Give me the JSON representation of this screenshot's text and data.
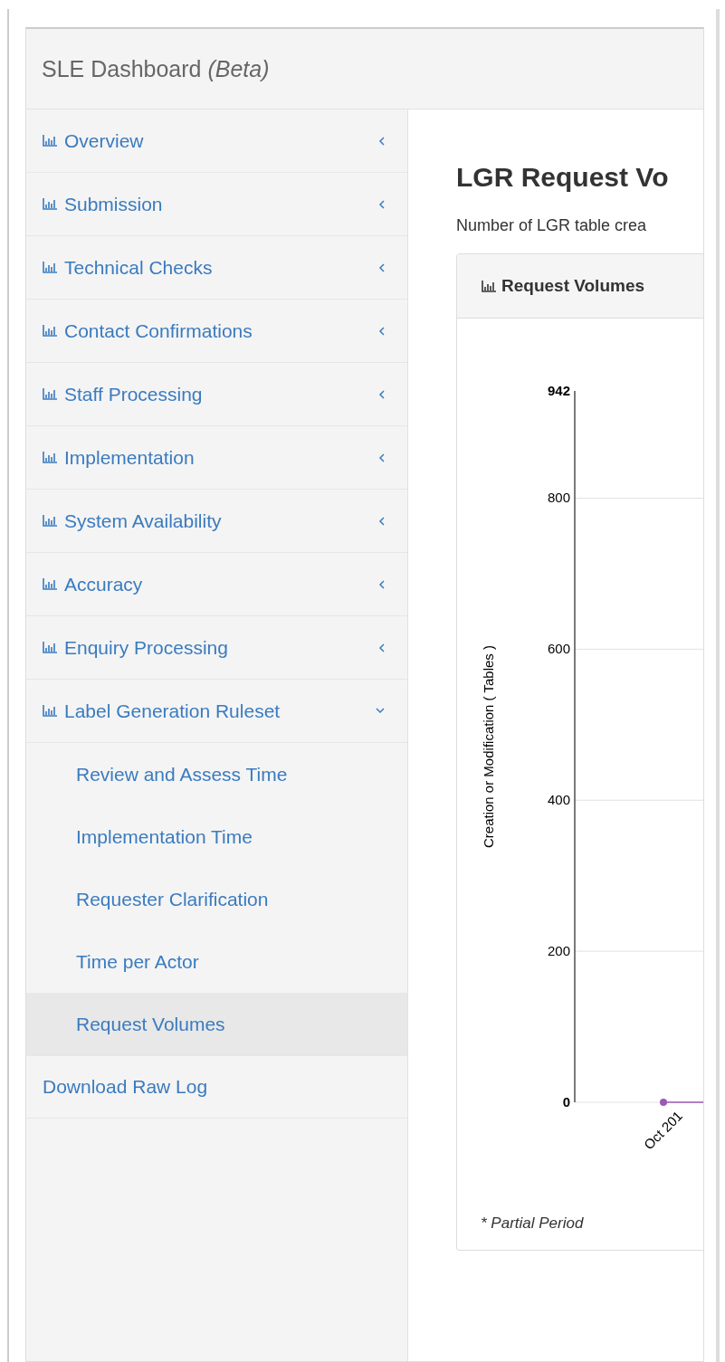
{
  "header": {
    "title": "SLE Dashboard",
    "badge": "(Beta)"
  },
  "sidebar": {
    "items": [
      {
        "kind": "group",
        "label": "Overview",
        "expanded": false
      },
      {
        "kind": "group",
        "label": "Submission",
        "expanded": false
      },
      {
        "kind": "group",
        "label": "Technical Checks",
        "expanded": false
      },
      {
        "kind": "group",
        "label": "Contact Confirmations",
        "expanded": false
      },
      {
        "kind": "group",
        "label": "Staff Processing",
        "expanded": false
      },
      {
        "kind": "group",
        "label": "Implementation",
        "expanded": false
      },
      {
        "kind": "group",
        "label": "System Availability",
        "expanded": false
      },
      {
        "kind": "group",
        "label": "Accuracy",
        "expanded": false
      },
      {
        "kind": "group",
        "label": "Enquiry Processing",
        "expanded": false
      },
      {
        "kind": "group",
        "label": "Label Generation Ruleset",
        "expanded": true,
        "children": [
          {
            "label": "Review and Assess Time",
            "selected": false
          },
          {
            "label": "Implementation Time",
            "selected": false
          },
          {
            "label": "Requester Clarification",
            "selected": false
          },
          {
            "label": "Time per Actor",
            "selected": false
          },
          {
            "label": "Request Volumes",
            "selected": true
          }
        ]
      },
      {
        "kind": "link",
        "label": "Download Raw Log"
      }
    ]
  },
  "content": {
    "title": "LGR Request Vo",
    "description": "Number of LGR table crea",
    "panel": {
      "title": "Request Volumes",
      "footnote": "* Partial Period",
      "chart_data": {
        "type": "line",
        "ylabel": "Creation or Modification ( Tables )",
        "categories": [
          "Oct 201"
        ],
        "grid": true,
        "series": [
          {
            "color": "#9b59b6",
            "marker": true,
            "values": [
              0
            ]
          }
        ],
        "ylim": [
          0,
          942
        ],
        "yticks": [
          0,
          200,
          400,
          600,
          800,
          942
        ]
      }
    }
  }
}
